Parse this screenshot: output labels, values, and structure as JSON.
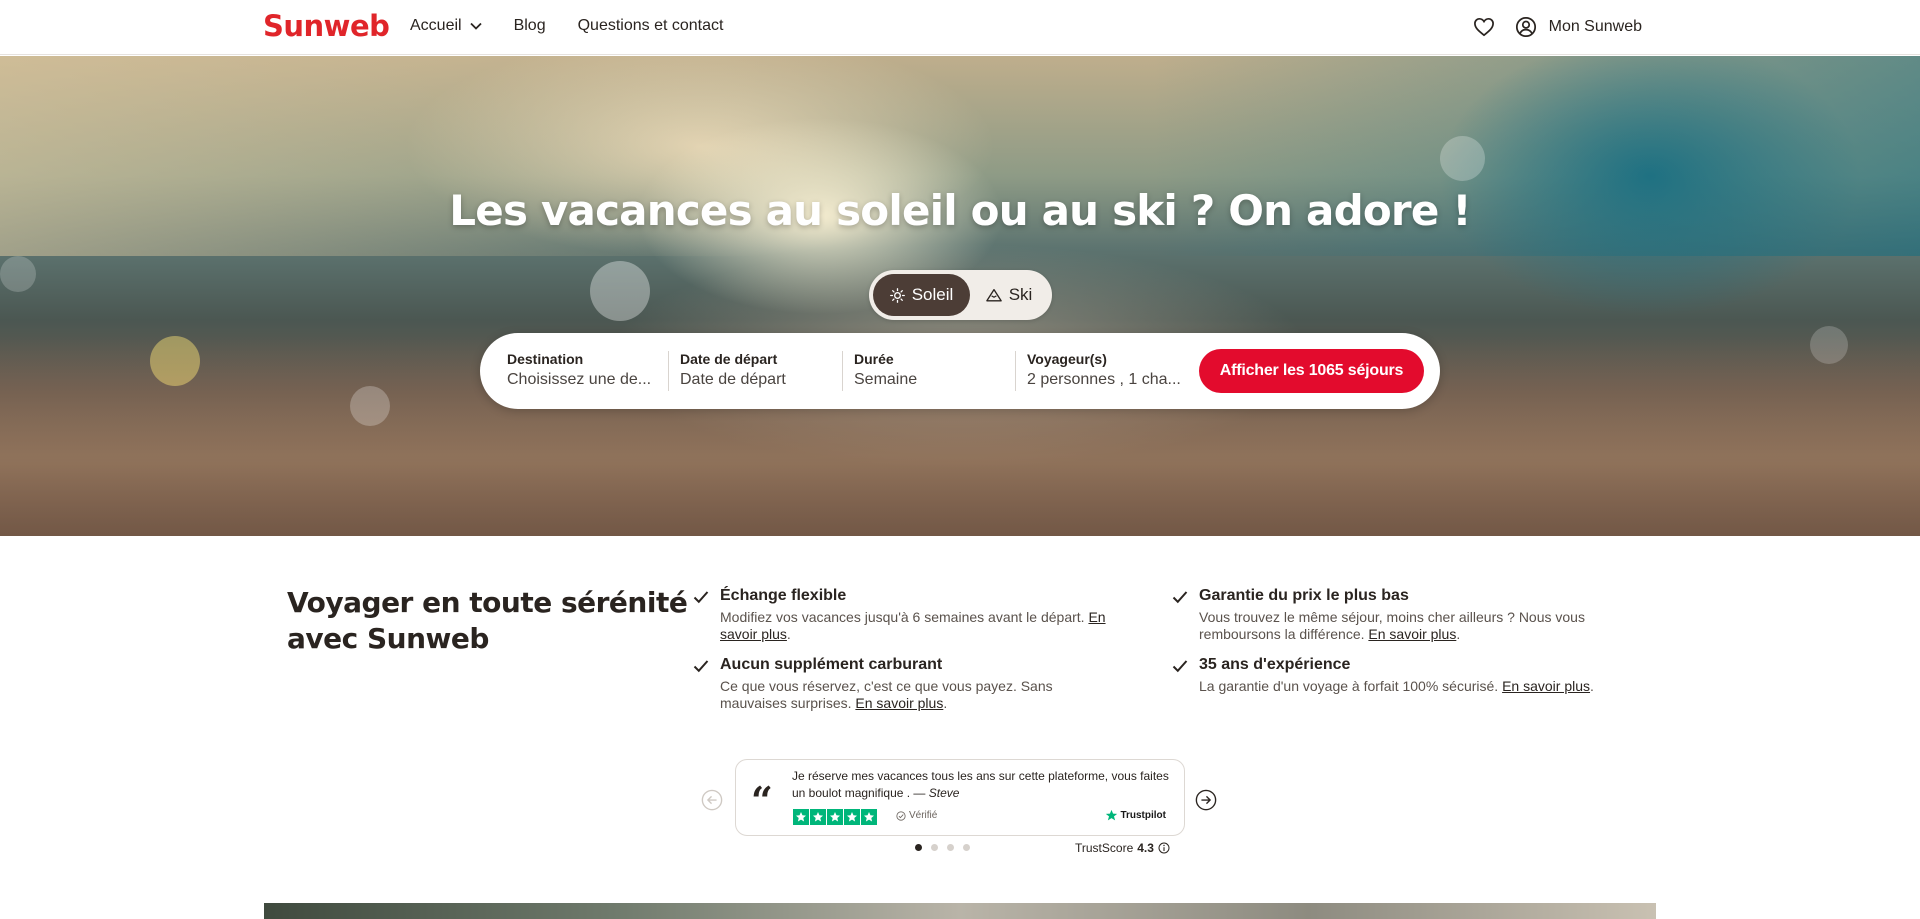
{
  "header": {
    "logo": "Sunweb",
    "nav": [
      {
        "label": "Accueil",
        "has_dropdown": true
      },
      {
        "label": "Blog"
      },
      {
        "label": "Questions et contact"
      }
    ],
    "account_label": "Mon Sunweb",
    "icons": [
      "heart-icon",
      "user-circle-icon"
    ]
  },
  "hero": {
    "title": "Les vacances au soleil ou au ski ? On adore !",
    "toggle": {
      "options": [
        {
          "label": "Soleil",
          "icon": "sun-icon",
          "active": true
        },
        {
          "label": "Ski",
          "icon": "mountain-icon",
          "active": false
        }
      ]
    },
    "search": {
      "fields": [
        {
          "label": "Destination",
          "value": "Choisissez une de..."
        },
        {
          "label": "Date de départ",
          "value": "Date de départ"
        },
        {
          "label": "Durée",
          "value": "Semaine"
        },
        {
          "label": "Voyageur(s)",
          "value": "2 personnes , 1 cha..."
        }
      ],
      "cta": "Afficher les 1065 séjours"
    }
  },
  "trust": {
    "title_line1": "Voyager en toute sérénité",
    "title_line2": "avec Sunweb",
    "features": [
      {
        "title": "Échange flexible",
        "desc": "Modifiez vos vacances jusqu'à 6 semaines avant le départ.",
        "link": "En savoir plus"
      },
      {
        "title": "Garantie du prix le plus bas",
        "desc": "Vous trouvez le même séjour, moins cher ailleurs ? Nous vous remboursons la différence.",
        "link": "En savoir plus"
      },
      {
        "title": "Aucun supplément carburant",
        "desc": "Ce que vous réservez, c'est ce que vous payez. Sans mauvaises surprises.",
        "link": "En savoir plus"
      },
      {
        "title": "35 ans d'expérience",
        "desc": "La garantie d'un voyage à forfait 100% sécurisé.",
        "link": "En savoir plus"
      }
    ]
  },
  "review": {
    "text": "Je réserve mes vacances tous les ans sur cette plateforme, vous faites un boulot magnifique . —",
    "author": "Steve",
    "verified": "Vérifié",
    "source": "Trustpilot",
    "rating_stars": 5,
    "trustscore_label": "TrustScore",
    "trustscore_value": "4.3",
    "pagination": {
      "count": 4,
      "active": 0
    }
  },
  "colors": {
    "brand_red": "#e0252a",
    "cta_red": "#e30b2d",
    "toggle_active": "#4c3d36",
    "trustpilot_green": "#00b67a"
  }
}
